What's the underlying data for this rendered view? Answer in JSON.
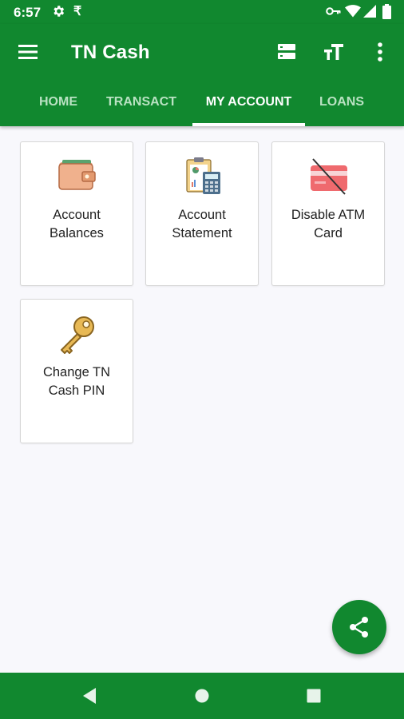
{
  "status_bar": {
    "time": "6:57",
    "rupee_symbol": "₹",
    "icons": [
      "gear-icon",
      "rupee-icon",
      "vpn-key-icon",
      "wifi-icon",
      "signal-icon",
      "battery-icon"
    ]
  },
  "app_bar": {
    "title": "TN Cash",
    "color": "#11882f",
    "actions": [
      "storage-icon",
      "text-size-icon",
      "more-vert-icon"
    ]
  },
  "tabs": [
    {
      "label": "HOME",
      "active": false
    },
    {
      "label": "TRANSACT",
      "active": false
    },
    {
      "label": "MY ACCOUNT",
      "active": true
    },
    {
      "label": "LOANS",
      "active": false
    }
  ],
  "cards": [
    {
      "label_line1": "Account",
      "label_line2": "Balances",
      "icon": "wallet-icon"
    },
    {
      "label_line1": "Account",
      "label_line2": "Statement",
      "icon": "statement-calculator-icon"
    },
    {
      "label_line1": "Disable ATM",
      "label_line2": "Card",
      "icon": "disabled-card-icon"
    },
    {
      "label_line1": "Change TN",
      "label_line2": "Cash PIN",
      "icon": "key-icon"
    }
  ],
  "fab": {
    "icon": "share-icon"
  },
  "nav_bar": {
    "icons": [
      "back-icon",
      "home-icon",
      "recents-icon"
    ]
  }
}
